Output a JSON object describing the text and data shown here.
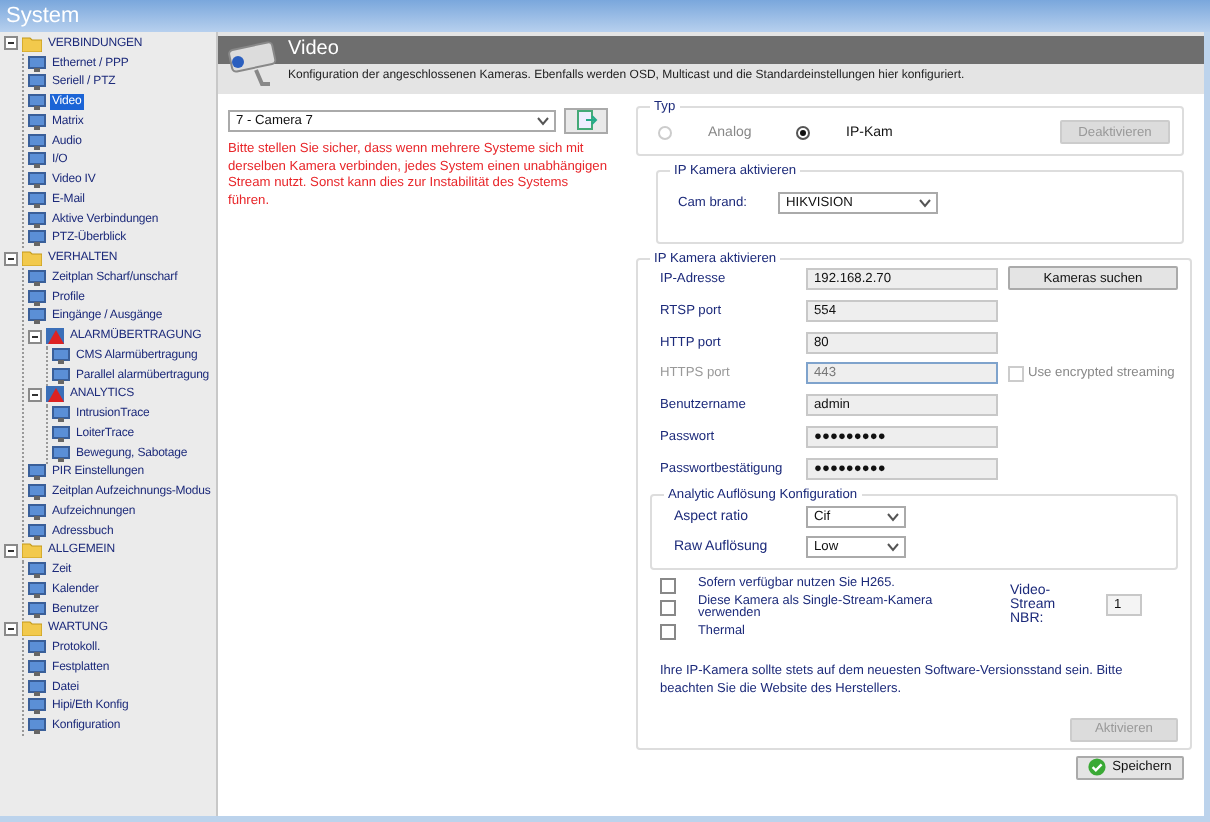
{
  "window": {
    "title": "System"
  },
  "sidebar": {
    "items": [
      {
        "label": "VERBINDUNGEN",
        "kind": "folder",
        "expanded": true,
        "selected": false,
        "children": [
          {
            "label": "Ethernet / PPP",
            "kind": "leaf",
            "selected": false
          },
          {
            "label": "Seriell / PTZ",
            "kind": "leaf",
            "selected": false
          },
          {
            "label": "Video",
            "kind": "leaf",
            "selected": true
          },
          {
            "label": "Matrix",
            "kind": "leaf",
            "selected": false
          },
          {
            "label": "Audio",
            "kind": "leaf",
            "selected": false
          },
          {
            "label": "I/O",
            "kind": "leaf",
            "selected": false
          },
          {
            "label": "Video IV",
            "kind": "leaf",
            "selected": false
          },
          {
            "label": "E-Mail",
            "kind": "leaf",
            "selected": false
          },
          {
            "label": "Aktive Verbindungen",
            "kind": "leaf",
            "selected": false
          },
          {
            "label": "PTZ-Überblick",
            "kind": "leaf",
            "selected": false
          }
        ]
      },
      {
        "label": "VERHALTEN",
        "kind": "folder",
        "expanded": true,
        "selected": false,
        "children": [
          {
            "label": "Zeitplan Scharf/unscharf",
            "kind": "leaf",
            "selected": false
          },
          {
            "label": "Profile",
            "kind": "leaf",
            "selected": false
          },
          {
            "label": "Eingänge / Ausgänge",
            "kind": "leaf",
            "selected": false
          },
          {
            "label": "ALARMÜBERTRAGUNG",
            "kind": "group",
            "expanded": true,
            "selected": false,
            "children": [
              {
                "label": "CMS Alarmübertragung",
                "kind": "leaf",
                "selected": false
              },
              {
                "label": "Parallel alarmübertragung",
                "kind": "leaf",
                "selected": false
              }
            ]
          },
          {
            "label": "ANALYTICS",
            "kind": "group",
            "expanded": true,
            "selected": false,
            "children": [
              {
                "label": "IntrusionTrace",
                "kind": "leaf",
                "selected": false
              },
              {
                "label": "LoiterTrace",
                "kind": "leaf",
                "selected": false
              },
              {
                "label": "Bewegung, Sabotage",
                "kind": "leaf",
                "selected": false
              }
            ]
          },
          {
            "label": "PIR Einstellungen",
            "kind": "leaf",
            "selected": false
          },
          {
            "label": "Zeitplan Aufzeichnungs-Modus",
            "kind": "leaf",
            "selected": false
          },
          {
            "label": "Aufzeichnungen",
            "kind": "leaf",
            "selected": false
          },
          {
            "label": "Adressbuch",
            "kind": "leaf",
            "selected": false
          }
        ]
      },
      {
        "label": "ALLGEMEIN",
        "kind": "folder",
        "expanded": true,
        "selected": false,
        "children": [
          {
            "label": "Zeit",
            "kind": "leaf",
            "selected": false
          },
          {
            "label": "Kalender",
            "kind": "leaf",
            "selected": false
          },
          {
            "label": "Benutzer",
            "kind": "leaf",
            "selected": false
          }
        ]
      },
      {
        "label": "WARTUNG",
        "kind": "folder",
        "expanded": true,
        "selected": false,
        "children": [
          {
            "label": "Protokoll.",
            "kind": "leaf",
            "selected": false
          },
          {
            "label": "Festplatten",
            "kind": "leaf",
            "selected": false
          },
          {
            "label": "Datei",
            "kind": "leaf",
            "selected": false
          },
          {
            "label": "Hipi/Eth Konfig",
            "kind": "leaf",
            "selected": false
          },
          {
            "label": "Konfiguration",
            "kind": "leaf",
            "selected": false
          }
        ]
      }
    ]
  },
  "header": {
    "title": "Video",
    "description": "Konfiguration der angeschlossenen Kameras. Ebenfalls werden OSD, Multicast und die Standardeinstellungen hier konfiguriert."
  },
  "camera_select": {
    "value": "7  - Camera 7"
  },
  "warning": "Bitte stellen Sie sicher, dass wenn mehrere Systeme sich mit derselben Kamera verbinden, jedes System einen unabhängigen Stream nutzt. Sonst kann dies zur Instabilität des Systems führen.",
  "type_group": {
    "legend": "Typ",
    "options": [
      {
        "label": "Analog",
        "selected": false,
        "disabled": true
      },
      {
        "label": "IP-Kam",
        "selected": true,
        "disabled": false
      }
    ],
    "button": {
      "label": "Deaktivieren",
      "disabled": true
    }
  },
  "brand_group": {
    "legend": "IP Kamera aktivieren",
    "label": "Cam brand:",
    "value": "HIKVISION"
  },
  "ip_group": {
    "legend": "IP Kamera aktivieren",
    "fields": [
      {
        "label": "IP-Adresse",
        "value": "192.168.2.70",
        "disabled": false
      },
      {
        "label": "RTSP port",
        "value": "554",
        "disabled": false
      },
      {
        "label": "HTTP port",
        "value": "80",
        "disabled": false
      },
      {
        "label": "HTTPS port",
        "value": "443",
        "disabled": true
      },
      {
        "label": "Benutzername",
        "value": "admin",
        "disabled": false
      },
      {
        "label": "Passwort",
        "value": "●●●●●●●●●",
        "disabled": false
      },
      {
        "label": "Passwortbestätigung",
        "value": "●●●●●●●●●",
        "disabled": false
      }
    ],
    "search_button": "Kameras suchen",
    "encrypted": {
      "label": "Use encrypted streaming",
      "checked": false,
      "disabled": true
    },
    "analytic": {
      "legend": "Analytic Auflösung Konfiguration",
      "selects": [
        {
          "label": "Aspect ratio",
          "value": "Cif"
        },
        {
          "label": "Raw Auflösung",
          "value": "Low"
        }
      ]
    },
    "checkboxes": [
      {
        "label": "Sofern verfügbar nutzen Sie H265.",
        "checked": false
      },
      {
        "label": "Diese Kamera als Single-Stream-Kamera verwenden",
        "checked": false
      },
      {
        "label": "Thermal",
        "checked": false
      }
    ],
    "stream_nbr": {
      "label": "Video-Stream NBR:",
      "value": "1"
    },
    "note": "Ihre IP-Kamera sollte stets auf dem neuesten Software-Versionsstand sein. Bitte beachten Sie die Website des Herstellers.",
    "activate_button": {
      "label": "Aktivieren",
      "disabled": true
    }
  },
  "save_button": "Speichern"
}
